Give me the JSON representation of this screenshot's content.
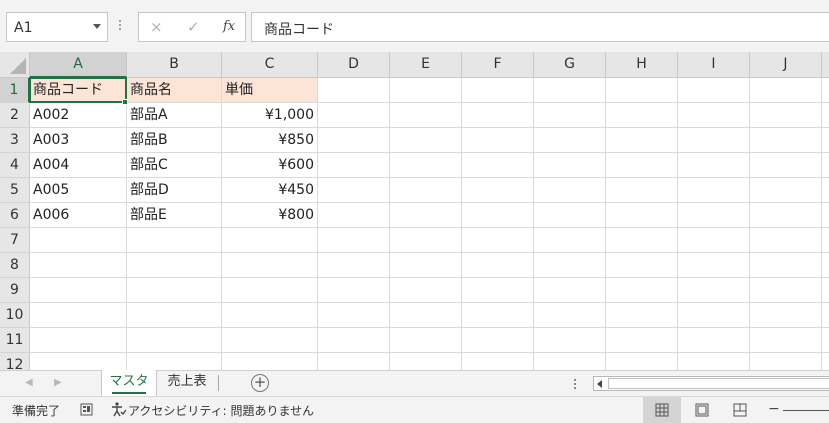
{
  "formula_bar": {
    "name_box": "A1",
    "cancel_icon": "×",
    "enter_icon": "✓",
    "fx_label": "fx",
    "content": "商品コード"
  },
  "columns": [
    "A",
    "B",
    "C",
    "D",
    "E",
    "F",
    "G",
    "H",
    "I",
    "J"
  ],
  "rows": [
    "1",
    "2",
    "3",
    "4",
    "5",
    "6",
    "7",
    "8",
    "9",
    "10",
    "11",
    "12"
  ],
  "table": {
    "headers": [
      "商品コード",
      "商品名",
      "単価"
    ],
    "data": [
      [
        "A002",
        "部品A",
        "¥1,000"
      ],
      [
        "A003",
        "部品B",
        "¥850"
      ],
      [
        "A004",
        "部品C",
        "¥600"
      ],
      [
        "A005",
        "部品D",
        "¥450"
      ],
      [
        "A006",
        "部品E",
        "¥800"
      ]
    ]
  },
  "sheet_tabs": [
    "マスタ",
    "売上表"
  ],
  "active_sheet": "マスタ",
  "add_sheet_icon": "+",
  "status": {
    "ready": "準備完了",
    "accessibility": "アクセシビリティ: 問題ありません",
    "zoom_minus": "−"
  },
  "colors": {
    "accent": "#217346",
    "header_fill": "#fce4d6",
    "selected_header": "#d2d2d2"
  }
}
